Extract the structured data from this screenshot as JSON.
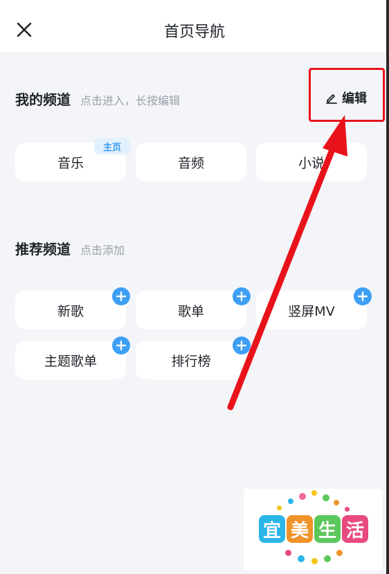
{
  "header": {
    "title": "首页导航",
    "close_icon": "close-icon"
  },
  "my_channels": {
    "title": "我的频道",
    "hint": "点击进入，长按编辑",
    "edit_label": "编辑",
    "edit_icon": "pencil-icon",
    "badge": "主页",
    "items": [
      {
        "label": "音乐"
      },
      {
        "label": "音频"
      },
      {
        "label": "小说"
      }
    ]
  },
  "recommended": {
    "title": "推荐频道",
    "hint": "点击添加",
    "items": [
      {
        "label": "新歌"
      },
      {
        "label": "歌单"
      },
      {
        "label": "竖屏MV"
      },
      {
        "label": "主题歌单"
      },
      {
        "label": "排行榜"
      }
    ]
  },
  "watermark": {
    "chars": [
      "宜",
      "美",
      "生",
      "活"
    ]
  },
  "colors": {
    "accent": "#3d9ff5",
    "highlight": "#e8131a",
    "background": "#f4f5f9",
    "watermark": [
      "#2bb6e8",
      "#f0932b",
      "#5cc85c",
      "#e84a7f"
    ]
  }
}
